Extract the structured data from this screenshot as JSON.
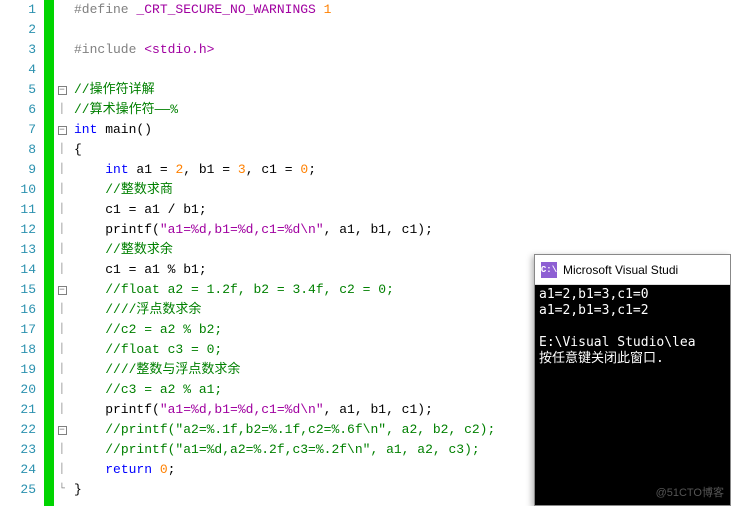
{
  "lines": [
    {
      "n": 1,
      "fold": "",
      "tokens": [
        {
          "c": "c-pre",
          "t": "#define "
        },
        {
          "c": "c-mac",
          "t": "_CRT_SECURE_NO_WARNINGS"
        },
        {
          "c": "c-txt",
          "t": " "
        },
        {
          "c": "c-num",
          "t": "1"
        }
      ]
    },
    {
      "n": 2,
      "fold": "",
      "tokens": []
    },
    {
      "n": 3,
      "fold": "",
      "tokens": [
        {
          "c": "c-pre",
          "t": "#include "
        },
        {
          "c": "c-str",
          "t": "<stdio.h>"
        }
      ]
    },
    {
      "n": 4,
      "fold": "",
      "tokens": []
    },
    {
      "n": 5,
      "fold": "minus",
      "tokens": [
        {
          "c": "c-cmt",
          "t": "//操作符详解"
        }
      ]
    },
    {
      "n": 6,
      "fold": "pipe",
      "tokens": [
        {
          "c": "c-cmt",
          "t": "//算术操作符——%"
        }
      ]
    },
    {
      "n": 7,
      "fold": "minus",
      "tokens": [
        {
          "c": "c-kw",
          "t": "int"
        },
        {
          "c": "c-txt",
          "t": " main"
        },
        {
          "c": "c-txt",
          "t": "()"
        }
      ]
    },
    {
      "n": 8,
      "fold": "pipe",
      "tokens": [
        {
          "c": "c-txt",
          "t": "{"
        }
      ]
    },
    {
      "n": 9,
      "fold": "pipe",
      "tokens": [
        {
          "c": "c-txt",
          "t": "    "
        },
        {
          "c": "c-kw",
          "t": "int"
        },
        {
          "c": "c-txt",
          "t": " a1 "
        },
        {
          "c": "c-txt",
          "t": "="
        },
        {
          "c": "c-txt",
          "t": " "
        },
        {
          "c": "c-num",
          "t": "2"
        },
        {
          "c": "c-txt",
          "t": ", b1 "
        },
        {
          "c": "c-txt",
          "t": "="
        },
        {
          "c": "c-txt",
          "t": " "
        },
        {
          "c": "c-num",
          "t": "3"
        },
        {
          "c": "c-txt",
          "t": ", c1 "
        },
        {
          "c": "c-txt",
          "t": "="
        },
        {
          "c": "c-txt",
          "t": " "
        },
        {
          "c": "c-num",
          "t": "0"
        },
        {
          "c": "c-txt",
          "t": ";"
        }
      ]
    },
    {
      "n": 10,
      "fold": "pipe",
      "tokens": [
        {
          "c": "c-txt",
          "t": "    "
        },
        {
          "c": "c-cmt",
          "t": "//整数求商"
        }
      ]
    },
    {
      "n": 11,
      "fold": "pipe",
      "tokens": [
        {
          "c": "c-txt",
          "t": "    c1 "
        },
        {
          "c": "c-txt",
          "t": "="
        },
        {
          "c": "c-txt",
          "t": " a1 "
        },
        {
          "c": "c-txt",
          "t": "/"
        },
        {
          "c": "c-txt",
          "t": " b1"
        },
        {
          "c": "c-txt",
          "t": ";"
        }
      ]
    },
    {
      "n": 12,
      "fold": "pipe",
      "tokens": [
        {
          "c": "c-txt",
          "t": "    printf"
        },
        {
          "c": "c-txt",
          "t": "("
        },
        {
          "c": "c-str",
          "t": "\"a1=%d,b1=%d,c1=%d\\n\""
        },
        {
          "c": "c-txt",
          "t": ", a1, b1, c1"
        },
        {
          "c": "c-txt",
          "t": ")"
        },
        {
          "c": "c-txt",
          "t": ";"
        }
      ]
    },
    {
      "n": 13,
      "fold": "pipe",
      "tokens": [
        {
          "c": "c-txt",
          "t": "    "
        },
        {
          "c": "c-cmt",
          "t": "//整数求余"
        }
      ]
    },
    {
      "n": 14,
      "fold": "pipe",
      "tokens": [
        {
          "c": "c-txt",
          "t": "    c1 "
        },
        {
          "c": "c-txt",
          "t": "="
        },
        {
          "c": "c-txt",
          "t": " a1 "
        },
        {
          "c": "c-txt",
          "t": "%"
        },
        {
          "c": "c-txt",
          "t": " b1"
        },
        {
          "c": "c-txt",
          "t": ";"
        }
      ]
    },
    {
      "n": 15,
      "fold": "minus",
      "tokens": [
        {
          "c": "c-txt",
          "t": "    "
        },
        {
          "c": "c-cmt",
          "t": "//float a2 = 1.2f, b2 = 3.4f, c2 = 0;"
        }
      ]
    },
    {
      "n": 16,
      "fold": "pipe",
      "tokens": [
        {
          "c": "c-txt",
          "t": "    "
        },
        {
          "c": "c-cmt",
          "t": "////浮点数求余"
        }
      ]
    },
    {
      "n": 17,
      "fold": "pipe",
      "tokens": [
        {
          "c": "c-txt",
          "t": "    "
        },
        {
          "c": "c-cmt",
          "t": "//c2 = a2 % b2;"
        }
      ]
    },
    {
      "n": 18,
      "fold": "pipe",
      "tokens": [
        {
          "c": "c-txt",
          "t": "    "
        },
        {
          "c": "c-cmt",
          "t": "//float c3 = 0;"
        }
      ]
    },
    {
      "n": 19,
      "fold": "pipe",
      "tokens": [
        {
          "c": "c-txt",
          "t": "    "
        },
        {
          "c": "c-cmt",
          "t": "////整数与浮点数求余"
        }
      ]
    },
    {
      "n": 20,
      "fold": "pipe",
      "tokens": [
        {
          "c": "c-txt",
          "t": "    "
        },
        {
          "c": "c-cmt",
          "t": "//c3 = a2 % a1;"
        }
      ]
    },
    {
      "n": 21,
      "fold": "pipe",
      "tokens": [
        {
          "c": "c-txt",
          "t": "    printf"
        },
        {
          "c": "c-txt",
          "t": "("
        },
        {
          "c": "c-str",
          "t": "\"a1=%d,b1=%d,c1=%d\\n\""
        },
        {
          "c": "c-txt",
          "t": ", a1, b1, c1"
        },
        {
          "c": "c-txt",
          "t": ")"
        },
        {
          "c": "c-txt",
          "t": ";"
        }
      ]
    },
    {
      "n": 22,
      "fold": "minus",
      "tokens": [
        {
          "c": "c-txt",
          "t": "    "
        },
        {
          "c": "c-cmt",
          "t": "//printf(\"a2=%.1f,b2=%.1f,c2=%.6f\\n\", a2, b2, c2);"
        }
      ]
    },
    {
      "n": 23,
      "fold": "pipe",
      "tokens": [
        {
          "c": "c-txt",
          "t": "    "
        },
        {
          "c": "c-cmt",
          "t": "//printf(\"a1=%d,a2=%.2f,c3=%.2f\\n\", a1, a2, c3);"
        }
      ]
    },
    {
      "n": 24,
      "fold": "pipe",
      "tokens": [
        {
          "c": "c-txt",
          "t": "    "
        },
        {
          "c": "c-kw",
          "t": "return"
        },
        {
          "c": "c-txt",
          "t": " "
        },
        {
          "c": "c-num",
          "t": "0"
        },
        {
          "c": "c-txt",
          "t": ";"
        }
      ]
    },
    {
      "n": 25,
      "fold": "end",
      "tokens": [
        {
          "c": "c-txt",
          "t": "}"
        }
      ]
    }
  ],
  "console": {
    "icon_text": "C:\\",
    "title": "Microsoft Visual Studi",
    "out1": "a1=2,b1=3,c1=0",
    "out2": "a1=2,b1=3,c1=2",
    "out3": "",
    "out4": "E:\\Visual Studio\\lea",
    "out5": "按任意键关闭此窗口."
  },
  "watermark": "@51CTO博客"
}
